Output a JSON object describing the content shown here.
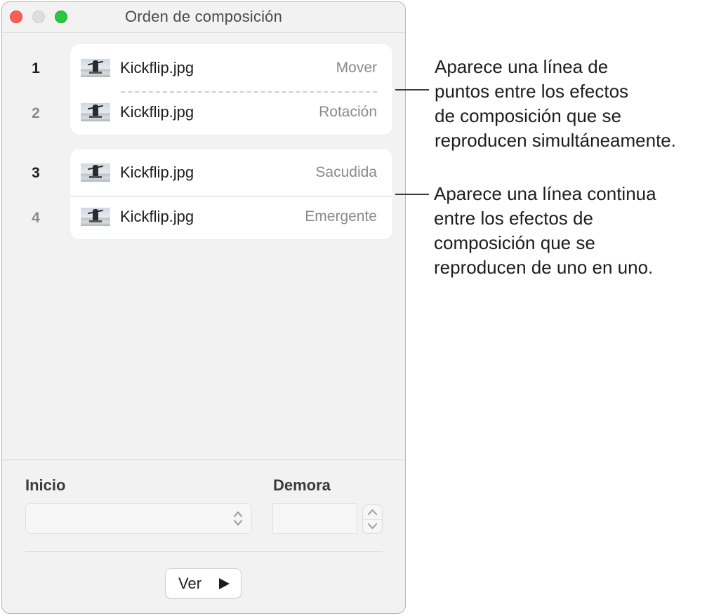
{
  "window": {
    "title": "Orden de composición"
  },
  "build_groups": [
    {
      "connector": "dotted",
      "items": [
        {
          "number": "1",
          "file": "Kickflip.jpg",
          "effect": "Mover",
          "selected": true
        },
        {
          "number": "2",
          "file": "Kickflip.jpg",
          "effect": "Rotación",
          "selected": false
        }
      ]
    },
    {
      "connector": "solid",
      "items": [
        {
          "number": "3",
          "file": "Kickflip.jpg",
          "effect": "Sacudida",
          "selected": true
        },
        {
          "number": "4",
          "file": "Kickflip.jpg",
          "effect": "Emergente",
          "selected": false
        }
      ]
    }
  ],
  "controls": {
    "start_label": "Inicio",
    "start_value": "",
    "delay_label": "Demora",
    "delay_value": "",
    "preview_button": "Ver"
  },
  "callouts": [
    {
      "text": "Aparece una línea de\npuntos entre los efectos\nde composición que se\nreproducen simultáneamente."
    },
    {
      "text": "Aparece una línea continua\nentre los efectos de\ncomposición que se\nreproducen de uno en uno."
    }
  ],
  "colors": {
    "close": "#ff5f57",
    "minimize": "#dedede",
    "zoom": "#28c840",
    "window_bg": "#f2f2f2",
    "group_bg": "#ffffff",
    "effect_text": "#8a8a8a"
  },
  "icons": {
    "thumbnail": "image-thumbnail-icon",
    "select_arrows": "up-down-chevron-icon",
    "stepper_up": "chevron-up-icon",
    "stepper_down": "chevron-down-icon",
    "play": "play-triangle-icon"
  }
}
